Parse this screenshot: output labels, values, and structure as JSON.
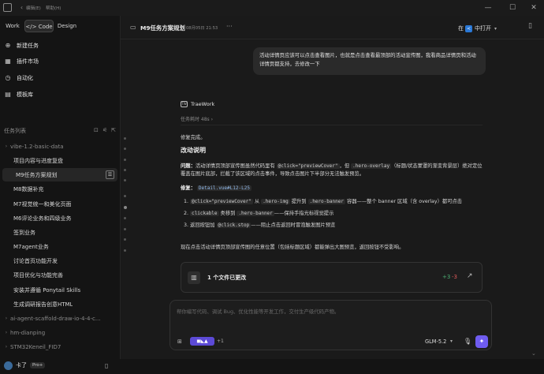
{
  "titlebar": {
    "menu_edit": "编辑(E)",
    "menu_help": "帮助(H)",
    "minimize": "—",
    "maximize": "☐",
    "close": "✕"
  },
  "sidebar": {
    "tabs": [
      {
        "label": "Work"
      },
      {
        "label": "</> Code"
      },
      {
        "label": "Design"
      }
    ],
    "nav": [
      {
        "label": "新建任务",
        "icon": "plus-circle-icon"
      },
      {
        "label": "插件市场",
        "icon": "grid-icon"
      },
      {
        "label": "自动化",
        "icon": "clock-icon"
      },
      {
        "label": "模板库",
        "icon": "book-icon"
      }
    ],
    "section_title": "任务列表",
    "tree": [
      {
        "label": "vibe-1.2-basic-data",
        "type": "folder"
      },
      {
        "label": "项目内容与进度复盘",
        "type": "item"
      },
      {
        "label": "M9任务方案规划",
        "type": "item",
        "selected": true
      },
      {
        "label": "M8数据补充",
        "type": "item"
      },
      {
        "label": "M7视觉统一和美化页面",
        "type": "item"
      },
      {
        "label": "M6评论业务和四级业务",
        "type": "item"
      },
      {
        "label": "签到业务",
        "type": "item"
      },
      {
        "label": "M7agent业务",
        "type": "item"
      },
      {
        "label": "讨论首页功能开发",
        "type": "item"
      },
      {
        "label": "项目优化与功能完善",
        "type": "item"
      },
      {
        "label": "安装并遵循 Ponytail Skills",
        "type": "item"
      },
      {
        "label": "生成调研报告创意HTML",
        "type": "item"
      },
      {
        "label": "ai-agent-scaffold-draw-io-4-4-c...",
        "type": "folder"
      },
      {
        "label": "hm-dianping",
        "type": "folder"
      },
      {
        "label": "STM32Keneil_FID7",
        "type": "folder"
      }
    ],
    "user": {
      "name": "卡了",
      "badge": "Pro+"
    }
  },
  "main": {
    "header": {
      "title": "M9任务方案规划",
      "time": "08月05日 21:53",
      "more": "···",
      "open_in": "在",
      "open_label": "中打开",
      "chevron": "▾"
    },
    "user_message": "活动详情页应该可以点击查看图片，也就是点击查看最顶部的活动宣传图，我看商品详情页和活动详情页都支持，去修改一下",
    "assistant": {
      "name": "TraeWork",
      "elapsed_label": "任务耗时 48s",
      "done": "修复完成。",
      "heading": "改动说明",
      "problem_label": "问题：",
      "problem_text_1": "活动详情页顶部宣传图虽然代码里有",
      "problem_code_1": "@click=\"previewCover\"",
      "problem_text_2": "，但",
      "problem_code_2": ".hero-overlay",
      "problem_text_3": "（标题/状态蒙罩的渐变背景层）绝对定位覆盖在图片底部，拦截了该区域的点击事件，导致点击图片下半部分无法触发预览。",
      "fix_label": "修复：",
      "fix_link": "Detail.vue#L12-L25",
      "list": [
        {
          "code": "@click=\"previewCover\"",
          "text_1": " 从 ",
          "code2": ".hero-img",
          "text_2": " 提升到 ",
          "code3": ".hero-banner",
          "text_3": " 容器——整个 banner 区域（含 overlay）都可点击"
        },
        {
          "code": "clickable",
          "text_1": " 类移到 ",
          "code2": ".hero-banner",
          "text_2": "——保持手指光标视觉提示",
          "code3": "",
          "text_3": ""
        },
        {
          "code": "",
          "text_1": "返回按钮加 ",
          "code2": "@click.stop",
          "text_2": "——阻止点击返回时冒泡触发图片预览",
          "code3": "",
          "text_3": ""
        }
      ],
      "summary": "现在点击活动详情页顶部宣传图的任意位置（包括标题区域）都能弹出大图预览，返回按钮不受影响。",
      "file_card": {
        "label": "1 个文件已更改",
        "additions": "+3",
        "deletions": "-3"
      }
    },
    "input": {
      "placeholder": "帮你编写代码、调试 Bug、优化性能等开发工作，交付生产级代码产物。",
      "plus_count": "+1",
      "model": "GLM-5.2",
      "model_chevron": "▾"
    }
  },
  "colors": {
    "accent": "#6f5cf0",
    "add": "#4caf73",
    "del": "#e05a5a",
    "link": "#8fb7e8"
  }
}
